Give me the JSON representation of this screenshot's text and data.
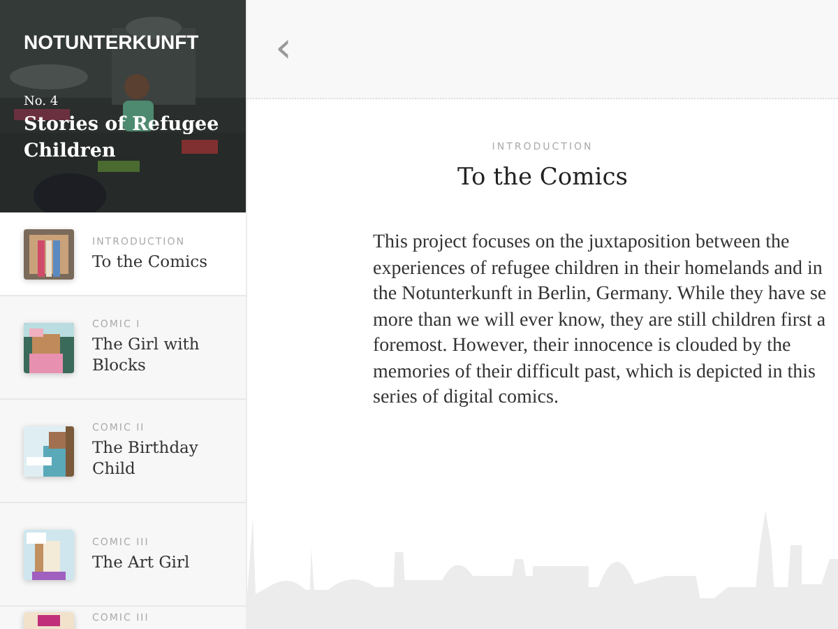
{
  "header": {
    "brand": "NOTUNTERKUNFT",
    "issue": "No. 4",
    "title": "Stories of Refugee Children"
  },
  "chapters": [
    {
      "label": "INTRODUCTION",
      "title": "To the Comics",
      "selected": true
    },
    {
      "label": "COMIC I",
      "title": "The Girl with Blocks",
      "selected": false
    },
    {
      "label": "COMIC II",
      "title": "The Birthday Child",
      "selected": false
    },
    {
      "label": "COMIC III",
      "title": "The Art Girl",
      "selected": false
    },
    {
      "label": "COMIC III",
      "selected": false
    }
  ],
  "back_icon": "‹",
  "article": {
    "label": "INTRODUCTION",
    "title": "To the Comics",
    "lines": [
      "This project focuses on the juxtaposition between the",
      "experiences of refugee children in their homelands and in",
      "the Notunterkunft in Berlin, Germany. While they have se",
      "more than we will ever know, they are still children first a",
      "foremost. However, their innocence is clouded by the",
      "memories of their difficult past, which is depicted in this",
      "series of digital comics."
    ]
  }
}
